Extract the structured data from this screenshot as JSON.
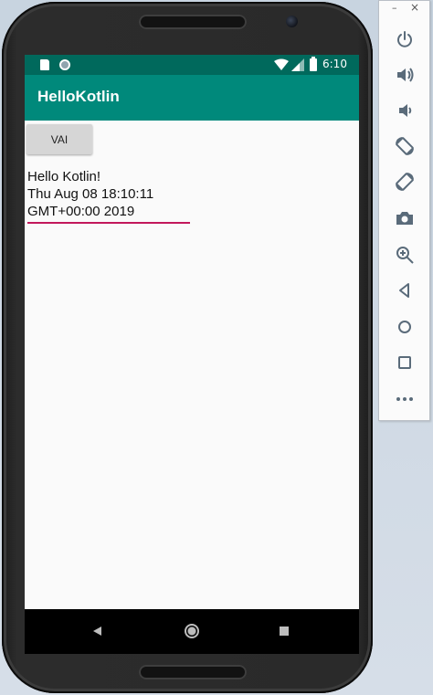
{
  "status_bar": {
    "time": "6:10"
  },
  "app": {
    "title": "HelloKotlin"
  },
  "main": {
    "button_label": "VAI",
    "output_lines": [
      "Hello Kotlin!",
      "Thu Aug 08 18:10:11",
      "GMT+00:00 2019"
    ]
  },
  "window_controls": {
    "minimize": "–",
    "close": "×"
  },
  "toolbar": {
    "items": [
      "power-icon",
      "volume-up-icon",
      "volume-down-icon",
      "rotate-left-icon",
      "rotate-right-icon",
      "camera-icon",
      "zoom-icon",
      "back-icon",
      "home-icon",
      "overview-icon",
      "more-icon"
    ]
  },
  "colors": {
    "status_bar": "#00695c",
    "app_bar": "#00897b",
    "accent_underline": "#c2185b",
    "toolbar_icon": "#5a6b7a"
  }
}
